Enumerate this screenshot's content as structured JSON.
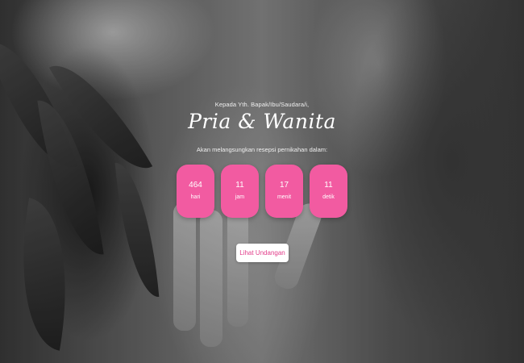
{
  "invitation": {
    "recipient_text": "Kepada Yth. Bapak/Ibu/Saudara/i,",
    "couple_names": "Pria & Wanita",
    "subtitle": "Akan melangsungkan resepsi pernikahan dalam:"
  },
  "countdown": [
    {
      "value": "464",
      "unit": "hari"
    },
    {
      "value": "11",
      "unit": "jam"
    },
    {
      "value": "17",
      "unit": "menit"
    },
    {
      "value": "11",
      "unit": "detik"
    }
  ],
  "actions": {
    "view_invitation_label": "Lihat Undangan"
  },
  "colors": {
    "accent": "#f25ba1",
    "button_text": "#e23d8a"
  },
  "background": {
    "icon": "wedding-hands-photo"
  }
}
